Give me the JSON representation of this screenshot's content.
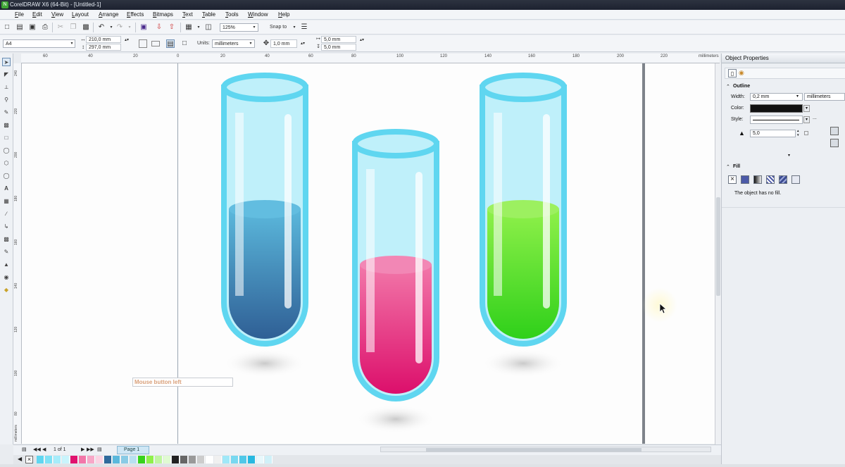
{
  "window": {
    "title": "CorelDRAW X6 (64-Bit) - [Untitled-1]",
    "app_icon_glyph": "N"
  },
  "menu": [
    "File",
    "Edit",
    "View",
    "Layout",
    "Arrange",
    "Effects",
    "Bitmaps",
    "Text",
    "Table",
    "Tools",
    "Window",
    "Help"
  ],
  "standard_toolbar": {
    "zoom": "125%",
    "snap_to": "Snap to"
  },
  "property_bar": {
    "page_size": "A4",
    "width": "210,0 mm",
    "height": "297,0 mm",
    "units_label": "Units:",
    "units_value": "millimeters",
    "nudge": "1,0 mm",
    "dup_x": "5,0 mm",
    "dup_y": "5,0 mm"
  },
  "ruler": {
    "h_labels": [
      "60",
      "40",
      "20",
      "0",
      "20",
      "40",
      "60",
      "80",
      "100",
      "120",
      "140",
      "160",
      "180",
      "200",
      "220"
    ],
    "h_unit": "millimeters",
    "v_labels": [
      "240",
      "220",
      "200",
      "180",
      "160",
      "140",
      "120",
      "100",
      "80",
      "60",
      "40"
    ],
    "v_unit": "millimeters"
  },
  "canvas": {
    "hint_text": "Mouse button left",
    "tubes": [
      {
        "name": "blue",
        "liquid_top": "#5bb8dc",
        "liquid_bottom": "#2f6a9c",
        "rim": "#5fd6f0"
      },
      {
        "name": "pink",
        "liquid_top": "#f277a9",
        "liquid_bottom": "#e0126e",
        "rim": "#5fd6f0"
      },
      {
        "name": "green",
        "liquid_top": "#8ff04a",
        "liquid_bottom": "#37d21c",
        "rim": "#5fd6f0"
      }
    ]
  },
  "page_nav": {
    "count": "1 of 1",
    "tab": "Page 1"
  },
  "palette": [
    "#5fd6f0",
    "#7fe1f5",
    "#a6ecfa",
    "#c9f4fc",
    "#e0126e",
    "#f277a9",
    "#f7a8c8",
    "#fbd3e3",
    "#2f6a9c",
    "#5bb8dc",
    "#89cbe5",
    "#b8e0f0",
    "#37d21c",
    "#8ff04a",
    "#c0f5a0",
    "#e0fad2",
    "#222222",
    "#666666",
    "#999999",
    "#cccccc",
    "#ffffff",
    "#f0f0f0",
    "#a0e8f8",
    "#78d8f0",
    "#50c8e8",
    "#28b8e0",
    "#e8f8fc",
    "#d0f0f8"
  ],
  "dock": {
    "title": "Object Properties",
    "outline": {
      "heading": "Outline",
      "width_label": "Width:",
      "width_value": "0,2 mm",
      "unit": "millimeters",
      "color_label": "Color:",
      "color": "#111111",
      "style_label": "Style:",
      "miter_value": "5,0",
      "more": "..."
    },
    "fill": {
      "heading": "Fill",
      "message": "The object has no fill."
    }
  }
}
